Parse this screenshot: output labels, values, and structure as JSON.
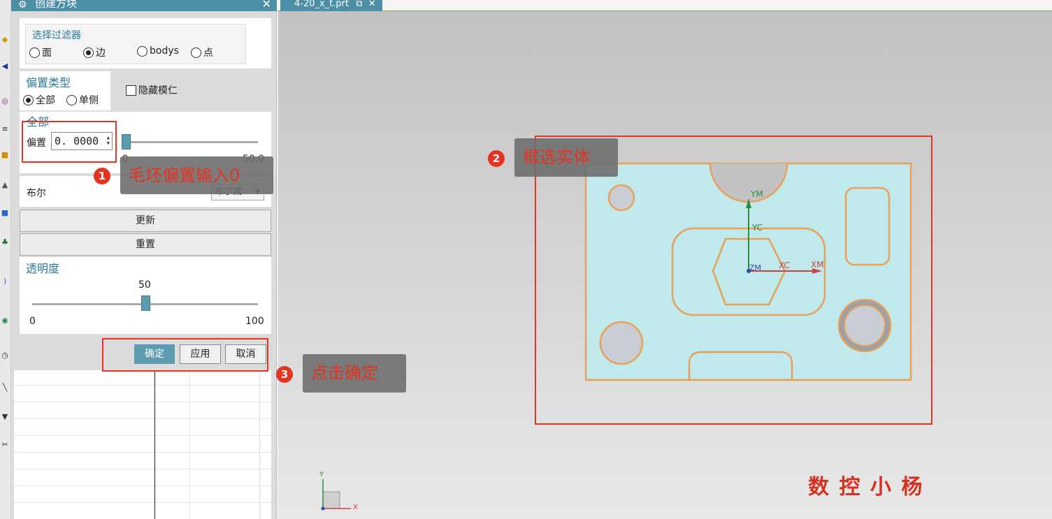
{
  "dialog": {
    "title": "创建方块",
    "filter": {
      "label": "选择过滤器",
      "options": [
        "面",
        "边",
        "bodys",
        "点"
      ],
      "selected": "边"
    },
    "offset_type": {
      "label": "偏置类型",
      "options": [
        "全部",
        "单侧"
      ],
      "selected": "全部",
      "hide_core_label": "隐藏模仁"
    },
    "all": {
      "label": "全部",
      "offset_label": "偏置",
      "offset_value": "0. 0000",
      "slider_min": ".0",
      "slider_max": "50.0",
      "slider_value": 0
    },
    "bool": {
      "label": "布尔",
      "value": "布尔减"
    },
    "update_button": "更新",
    "reset_button": "重置",
    "transparency": {
      "label": "透明度",
      "value": "50",
      "min": "0",
      "max": "100",
      "fraction": 0.5
    },
    "ok_button": "确定",
    "apply_button": "应用",
    "cancel_button": "取消"
  },
  "tab": {
    "label": "4-20_x_t.prt"
  },
  "annotations": {
    "step1_badge": "1",
    "step1_text": "毛坯偏置输入0",
    "step2_badge": "2",
    "step2_text": "框选实体",
    "step3_badge": "3",
    "step3_text": "点击确定"
  },
  "axes": {
    "ym": "YM",
    "yc": "YC",
    "xc": "XC",
    "xm": "XM",
    "zm": "ZM",
    "triad_y": "Y",
    "triad_x": "X"
  },
  "watermark": "数 控 小 杨",
  "colors": {
    "accent": "#4d8fa6",
    "annotation_red": "#e53322",
    "part_fill": "#bfe9ea",
    "part_edge": "#e8a05a",
    "hole_fill": "#c8ced3"
  }
}
